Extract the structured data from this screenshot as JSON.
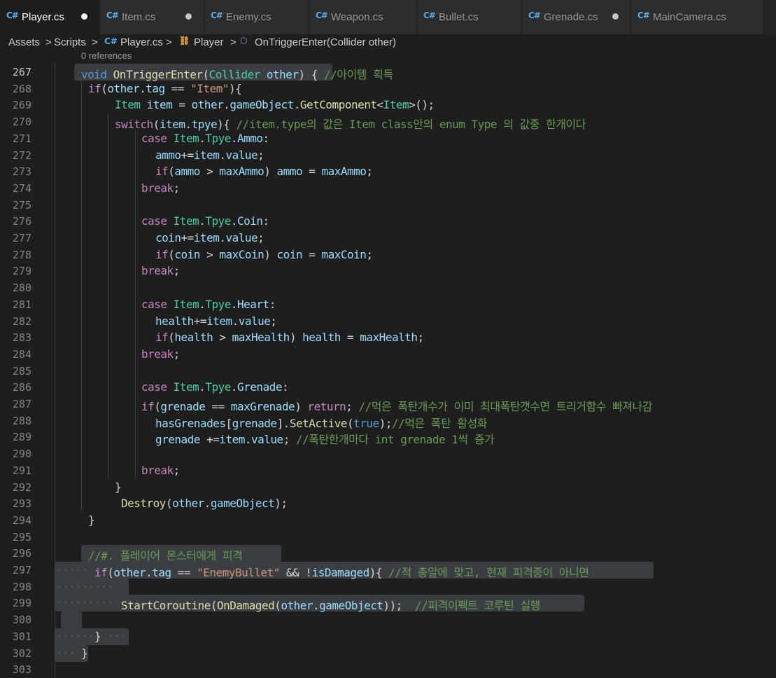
{
  "tabs": [
    {
      "label": "Player.cs",
      "active": true,
      "modified": true
    },
    {
      "label": "Item.cs",
      "active": false,
      "modified": true
    },
    {
      "label": "Enemy.cs",
      "active": false,
      "modified": false
    },
    {
      "label": "Weapon.cs",
      "active": false,
      "modified": false
    },
    {
      "label": "Bullet.cs",
      "active": false,
      "modified": false
    },
    {
      "label": "Grenade.cs",
      "active": false,
      "modified": true
    },
    {
      "label": "MainCamera.cs",
      "active": false,
      "modified": false
    }
  ],
  "tab_icon": "C#",
  "breadcrumb": {
    "items": [
      "Assets",
      "Scripts",
      "Player.cs",
      "Player",
      "OnTriggerEnter(Collider other)"
    ],
    "separator": ">"
  },
  "codelens": "0 references",
  "editor": {
    "current_line": "267",
    "lines": [
      {
        "n": "267",
        "tokens": [
          [
            "k",
            "void"
          ],
          [
            "p",
            " "
          ],
          [
            "f",
            "OnTriggerEnter"
          ],
          [
            "p",
            "("
          ],
          [
            "t",
            "Collider"
          ],
          [
            "p",
            " "
          ],
          [
            "v",
            "other"
          ],
          [
            "p",
            ") { "
          ],
          [
            "m",
            "//아이템 획득"
          ]
        ]
      },
      {
        "n": "268",
        "tokens": [
          [
            "c",
            "if"
          ],
          [
            "p",
            "("
          ],
          [
            "v",
            "other"
          ],
          [
            "p",
            "."
          ],
          [
            "v",
            "tag"
          ],
          [
            "p",
            " == "
          ],
          [
            "s",
            "\"Item\""
          ],
          [
            "p",
            "){"
          ]
        ]
      },
      {
        "n": "269",
        "tokens": [
          [
            "t",
            "Item"
          ],
          [
            "p",
            " "
          ],
          [
            "v",
            "item"
          ],
          [
            "p",
            " = "
          ],
          [
            "v",
            "other"
          ],
          [
            "p",
            "."
          ],
          [
            "v",
            "gameObject"
          ],
          [
            "p",
            "."
          ],
          [
            "f",
            "GetComponent"
          ],
          [
            "p",
            "<"
          ],
          [
            "t",
            "Item"
          ],
          [
            "p",
            ">();"
          ]
        ]
      },
      {
        "n": "270",
        "tokens": [
          [
            "c",
            "switch"
          ],
          [
            "p",
            "("
          ],
          [
            "v",
            "item"
          ],
          [
            "p",
            "."
          ],
          [
            "v",
            "tpye"
          ],
          [
            "p",
            "){ "
          ],
          [
            "m",
            "//item.type의 값은 Item class안의 enum Type 의 값중 한개이다"
          ]
        ]
      },
      {
        "n": "271",
        "tokens": [
          [
            "c",
            "case"
          ],
          [
            "p",
            " "
          ],
          [
            "t",
            "Item"
          ],
          [
            "p",
            "."
          ],
          [
            "t",
            "Tpye"
          ],
          [
            "p",
            "."
          ],
          [
            "v",
            "Ammo"
          ],
          [
            "p",
            ":"
          ]
        ]
      },
      {
        "n": "272",
        "tokens": [
          [
            "v",
            "ammo"
          ],
          [
            "p",
            "+="
          ],
          [
            "v",
            "item"
          ],
          [
            "p",
            "."
          ],
          [
            "v",
            "value"
          ],
          [
            "p",
            ";"
          ]
        ]
      },
      {
        "n": "273",
        "tokens": [
          [
            "c",
            "if"
          ],
          [
            "p",
            "("
          ],
          [
            "v",
            "ammo"
          ],
          [
            "p",
            " > "
          ],
          [
            "v",
            "maxAmmo"
          ],
          [
            "p",
            ") "
          ],
          [
            "v",
            "ammo"
          ],
          [
            "p",
            " = "
          ],
          [
            "v",
            "maxAmmo"
          ],
          [
            "p",
            ";"
          ]
        ]
      },
      {
        "n": "274",
        "tokens": [
          [
            "c",
            "break"
          ],
          [
            "p",
            ";"
          ]
        ]
      },
      {
        "n": "275",
        "tokens": []
      },
      {
        "n": "276",
        "tokens": [
          [
            "c",
            "case"
          ],
          [
            "p",
            " "
          ],
          [
            "t",
            "Item"
          ],
          [
            "p",
            "."
          ],
          [
            "t",
            "Tpye"
          ],
          [
            "p",
            "."
          ],
          [
            "v",
            "Coin"
          ],
          [
            "p",
            ":"
          ]
        ]
      },
      {
        "n": "277",
        "tokens": [
          [
            "v",
            "coin"
          ],
          [
            "p",
            "+="
          ],
          [
            "v",
            "item"
          ],
          [
            "p",
            "."
          ],
          [
            "v",
            "value"
          ],
          [
            "p",
            ";"
          ]
        ]
      },
      {
        "n": "278",
        "tokens": [
          [
            "c",
            "if"
          ],
          [
            "p",
            "("
          ],
          [
            "v",
            "coin"
          ],
          [
            "p",
            " > "
          ],
          [
            "v",
            "maxCoin"
          ],
          [
            "p",
            ") "
          ],
          [
            "v",
            "coin"
          ],
          [
            "p",
            " = "
          ],
          [
            "v",
            "maxCoin"
          ],
          [
            "p",
            ";"
          ]
        ]
      },
      {
        "n": "279",
        "tokens": [
          [
            "c",
            "break"
          ],
          [
            "p",
            ";"
          ]
        ]
      },
      {
        "n": "280",
        "tokens": []
      },
      {
        "n": "281",
        "tokens": [
          [
            "c",
            "case"
          ],
          [
            "p",
            " "
          ],
          [
            "t",
            "Item"
          ],
          [
            "p",
            "."
          ],
          [
            "t",
            "Tpye"
          ],
          [
            "p",
            "."
          ],
          [
            "v",
            "Heart"
          ],
          [
            "p",
            ":"
          ]
        ]
      },
      {
        "n": "282",
        "tokens": [
          [
            "v",
            "health"
          ],
          [
            "p",
            "+="
          ],
          [
            "v",
            "item"
          ],
          [
            "p",
            "."
          ],
          [
            "v",
            "value"
          ],
          [
            "p",
            ";"
          ]
        ]
      },
      {
        "n": "283",
        "tokens": [
          [
            "c",
            "if"
          ],
          [
            "p",
            "("
          ],
          [
            "v",
            "health"
          ],
          [
            "p",
            " > "
          ],
          [
            "v",
            "maxHealth"
          ],
          [
            "p",
            ") "
          ],
          [
            "v",
            "health"
          ],
          [
            "p",
            " = "
          ],
          [
            "v",
            "maxHealth"
          ],
          [
            "p",
            ";"
          ]
        ]
      },
      {
        "n": "284",
        "tokens": [
          [
            "c",
            "break"
          ],
          [
            "p",
            ";"
          ]
        ]
      },
      {
        "n": "285",
        "tokens": []
      },
      {
        "n": "286",
        "tokens": [
          [
            "c",
            "case"
          ],
          [
            "p",
            " "
          ],
          [
            "t",
            "Item"
          ],
          [
            "p",
            "."
          ],
          [
            "t",
            "Tpye"
          ],
          [
            "p",
            "."
          ],
          [
            "v",
            "Grenade"
          ],
          [
            "p",
            ":"
          ]
        ]
      },
      {
        "n": "287",
        "tokens": [
          [
            "c",
            "if"
          ],
          [
            "p",
            "("
          ],
          [
            "v",
            "grenade"
          ],
          [
            "p",
            " == "
          ],
          [
            "v",
            "maxGrenade"
          ],
          [
            "p",
            ") "
          ],
          [
            "c",
            "return"
          ],
          [
            "p",
            "; "
          ],
          [
            "m",
            "//먹은 폭탄개수가 이미 최대폭탄갯수면 트리거함수 빠져나감"
          ]
        ]
      },
      {
        "n": "288",
        "tokens": [
          [
            "v",
            "hasGrenades"
          ],
          [
            "p",
            "["
          ],
          [
            "v",
            "grenade"
          ],
          [
            "p",
            "]."
          ],
          [
            "f",
            "SetActive"
          ],
          [
            "p",
            "("
          ],
          [
            "k",
            "true"
          ],
          [
            "p",
            ");"
          ],
          [
            "m",
            "//먹은 폭탄 활성화"
          ]
        ]
      },
      {
        "n": "289",
        "tokens": [
          [
            "v",
            "grenade"
          ],
          [
            "p",
            " +="
          ],
          [
            "v",
            "item"
          ],
          [
            "p",
            "."
          ],
          [
            "v",
            "value"
          ],
          [
            "p",
            "; "
          ],
          [
            "m",
            "//폭탄한개마다 int grenade 1씩 증가"
          ]
        ]
      },
      {
        "n": "290",
        "tokens": []
      },
      {
        "n": "291",
        "tokens": [
          [
            "c",
            "break"
          ],
          [
            "p",
            ";"
          ]
        ]
      },
      {
        "n": "292",
        "tokens": [
          [
            "p",
            "}"
          ]
        ]
      },
      {
        "n": "293",
        "tokens": [
          [
            "f",
            "Destroy"
          ],
          [
            "p",
            "("
          ],
          [
            "v",
            "other"
          ],
          [
            "p",
            "."
          ],
          [
            "v",
            "gameObject"
          ],
          [
            "p",
            ");"
          ]
        ]
      },
      {
        "n": "294",
        "tokens": [
          [
            "p",
            "}"
          ]
        ]
      },
      {
        "n": "295",
        "tokens": []
      },
      {
        "n": "296",
        "tokens": [
          [
            "m",
            "//#. 플레이어 몬스터에게 피격"
          ]
        ]
      },
      {
        "n": "297",
        "tokens": [
          [
            "c",
            "if"
          ],
          [
            "p",
            "("
          ],
          [
            "v",
            "other"
          ],
          [
            "p",
            "."
          ],
          [
            "v",
            "tag"
          ],
          [
            "p",
            " == "
          ],
          [
            "s",
            "\"EnemyBullet\""
          ],
          [
            "p",
            " && !"
          ],
          [
            "v",
            "isDamaged"
          ],
          [
            "p",
            "){ "
          ],
          [
            "m",
            "//적 총알에 맞고, 현재 피격중이 아니면"
          ]
        ]
      },
      {
        "n": "298",
        "tokens": []
      },
      {
        "n": "299",
        "tokens": [
          [
            "f",
            "StartCoroutine"
          ],
          [
            "p",
            "("
          ],
          [
            "f",
            "OnDamaged"
          ],
          [
            "p",
            "("
          ],
          [
            "v",
            "other"
          ],
          [
            "p",
            "."
          ],
          [
            "v",
            "gameObject"
          ],
          [
            "p",
            "));  "
          ],
          [
            "m",
            "//피격이펙트 코루틴 실행"
          ]
        ]
      },
      {
        "n": "300",
        "tokens": []
      },
      {
        "n": "301",
        "tokens": [
          [
            "p",
            "}"
          ]
        ]
      },
      {
        "n": "302",
        "tokens": [
          [
            "p",
            "}"
          ]
        ]
      },
      {
        "n": "303",
        "tokens": []
      }
    ]
  }
}
